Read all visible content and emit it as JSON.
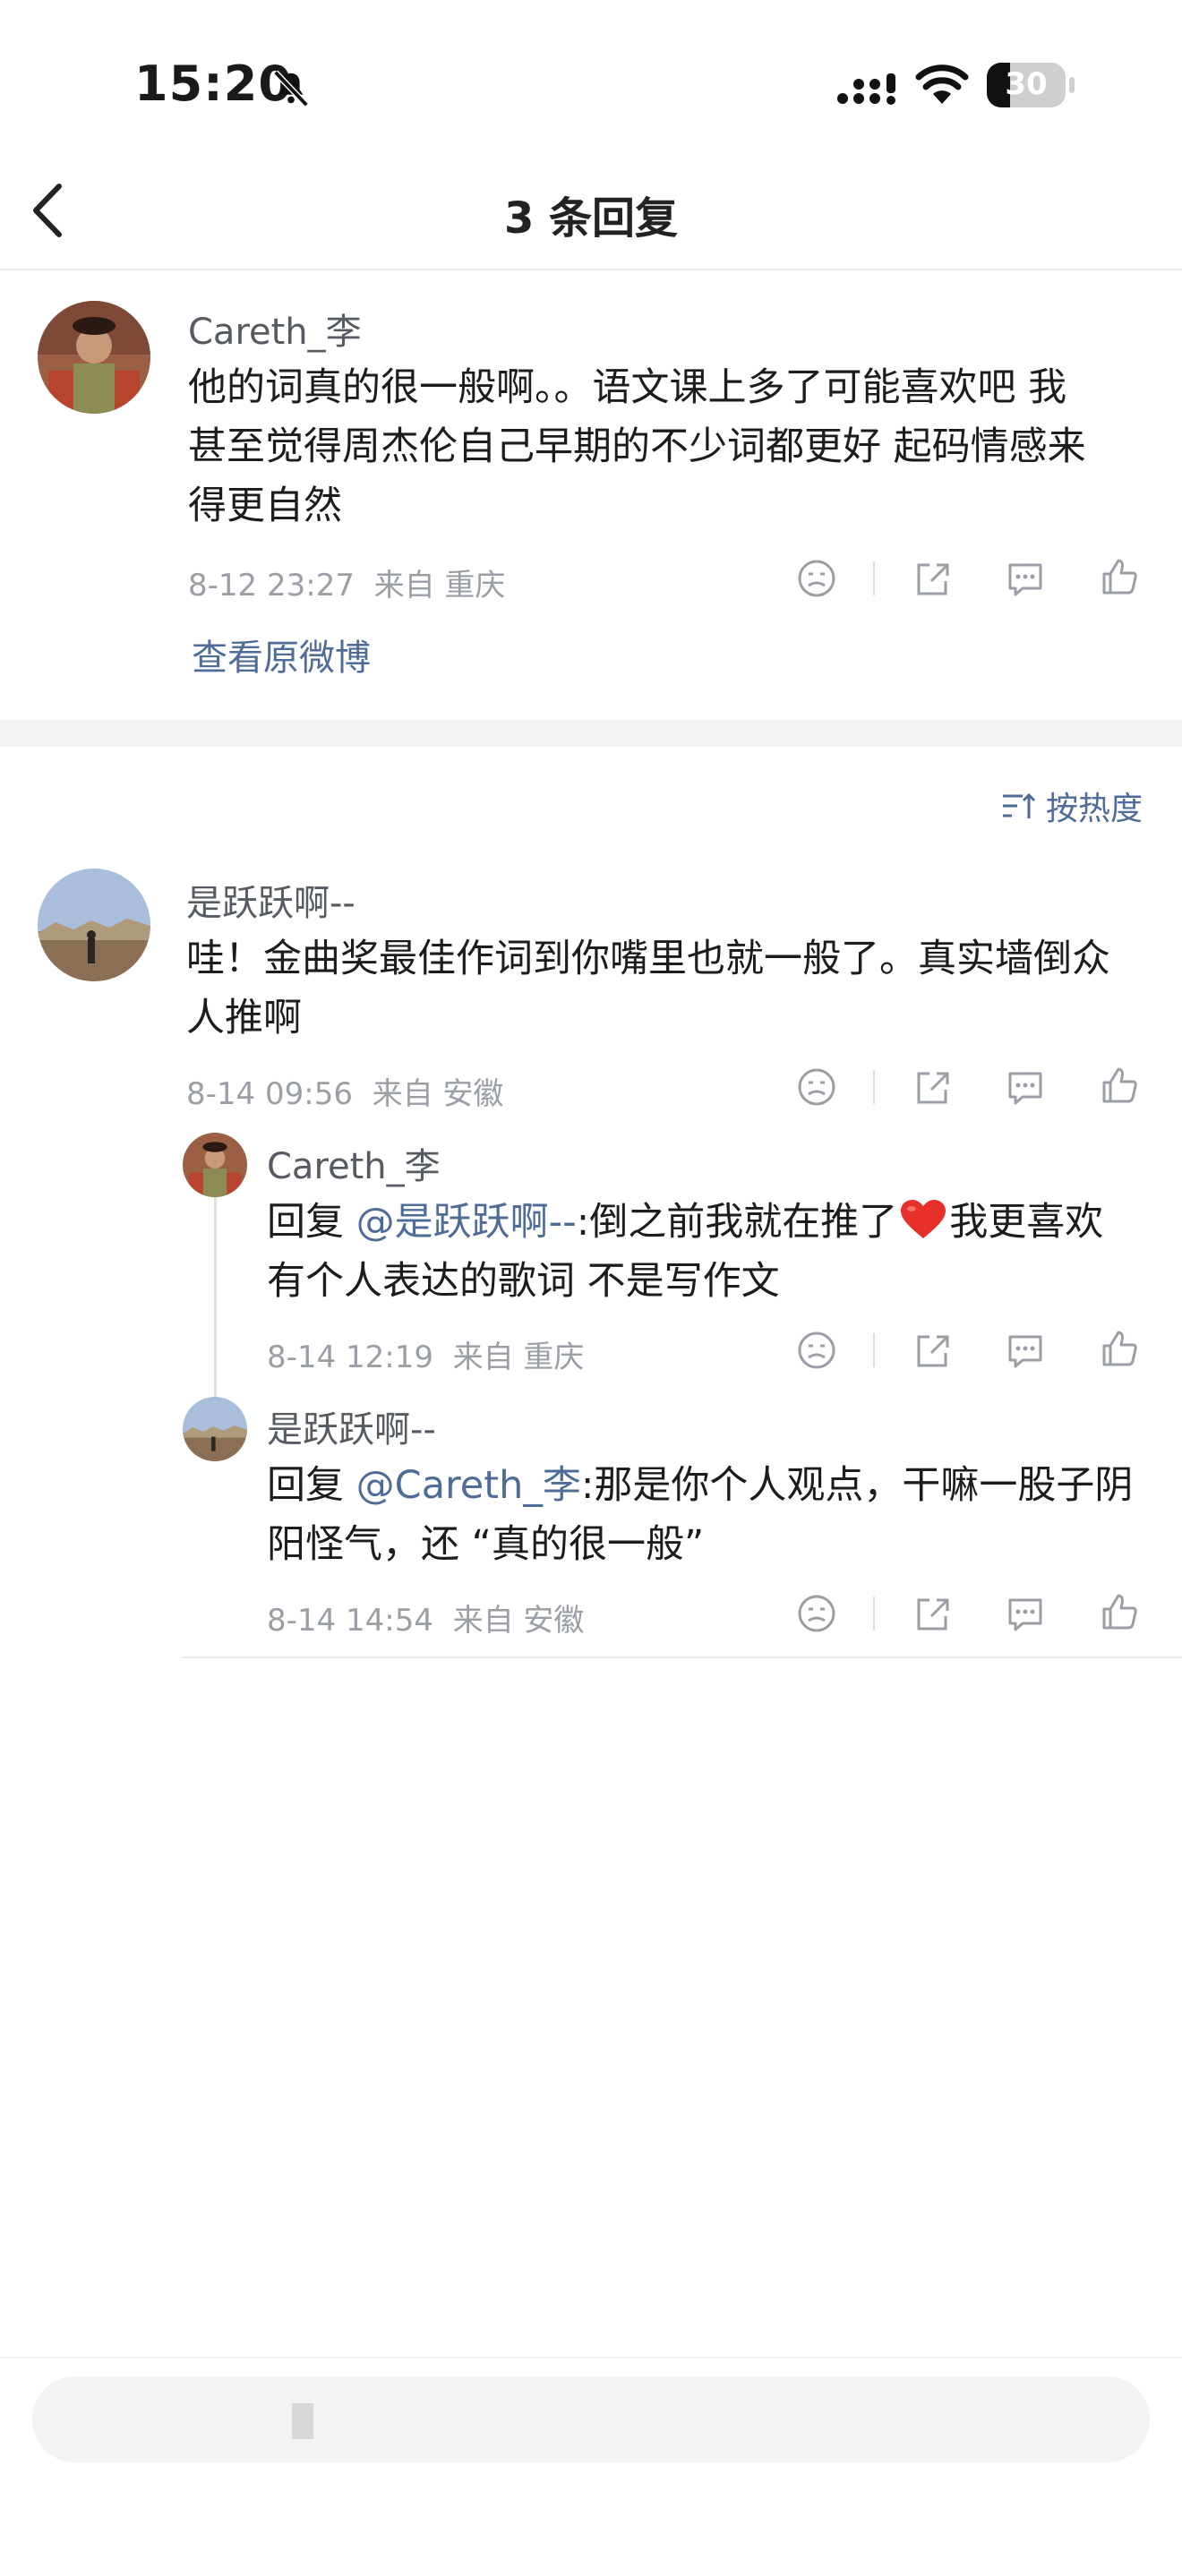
{
  "status_bar": {
    "time": "15:20",
    "battery": "30",
    "battery_level": 0.3
  },
  "header": {
    "title": "3 条回复"
  },
  "main_comment": {
    "author": "Careth_李",
    "text_lines": [
      "他的词真的很一般啊。。语文课上多了可能喜欢吧 我",
      "甚至觉得周杰伦自己早期的不少词都更好 起码情感来",
      "得更自然"
    ],
    "meta": "8-12 23:27  来自 重庆",
    "view_original": "查看原微博"
  },
  "sort_label": "按热度",
  "reply": {
    "author": "是跃跃啊--",
    "text_lines": [
      "哇！金曲奖最佳作词到你嘴里也就一般了。真实墙倒众",
      "人推啊"
    ],
    "meta": "8-14 09:56  来自 安徽"
  },
  "sub_replies": [
    {
      "author": "Careth_李",
      "prefix": "回复 ",
      "mention": "@是跃跃啊--",
      "line1_rest": ":倒之前我就在推了",
      "line1_after": "我更喜欢",
      "line2": "有个人表达的歌词 不是写作文",
      "meta": "8-14 12:19  来自 重庆"
    },
    {
      "author": "是跃跃啊--",
      "prefix": "回复 ",
      "mention": "@Careth_李",
      "line1_rest": ":那是你个人观点，干嘛一股子阴",
      "line2": "阳怪气，还 “真的很一般”",
      "meta": "8-14 14:54  来自 安徽"
    }
  ],
  "colors": {
    "link": "#4f6c99",
    "heart": "#e8302a"
  }
}
